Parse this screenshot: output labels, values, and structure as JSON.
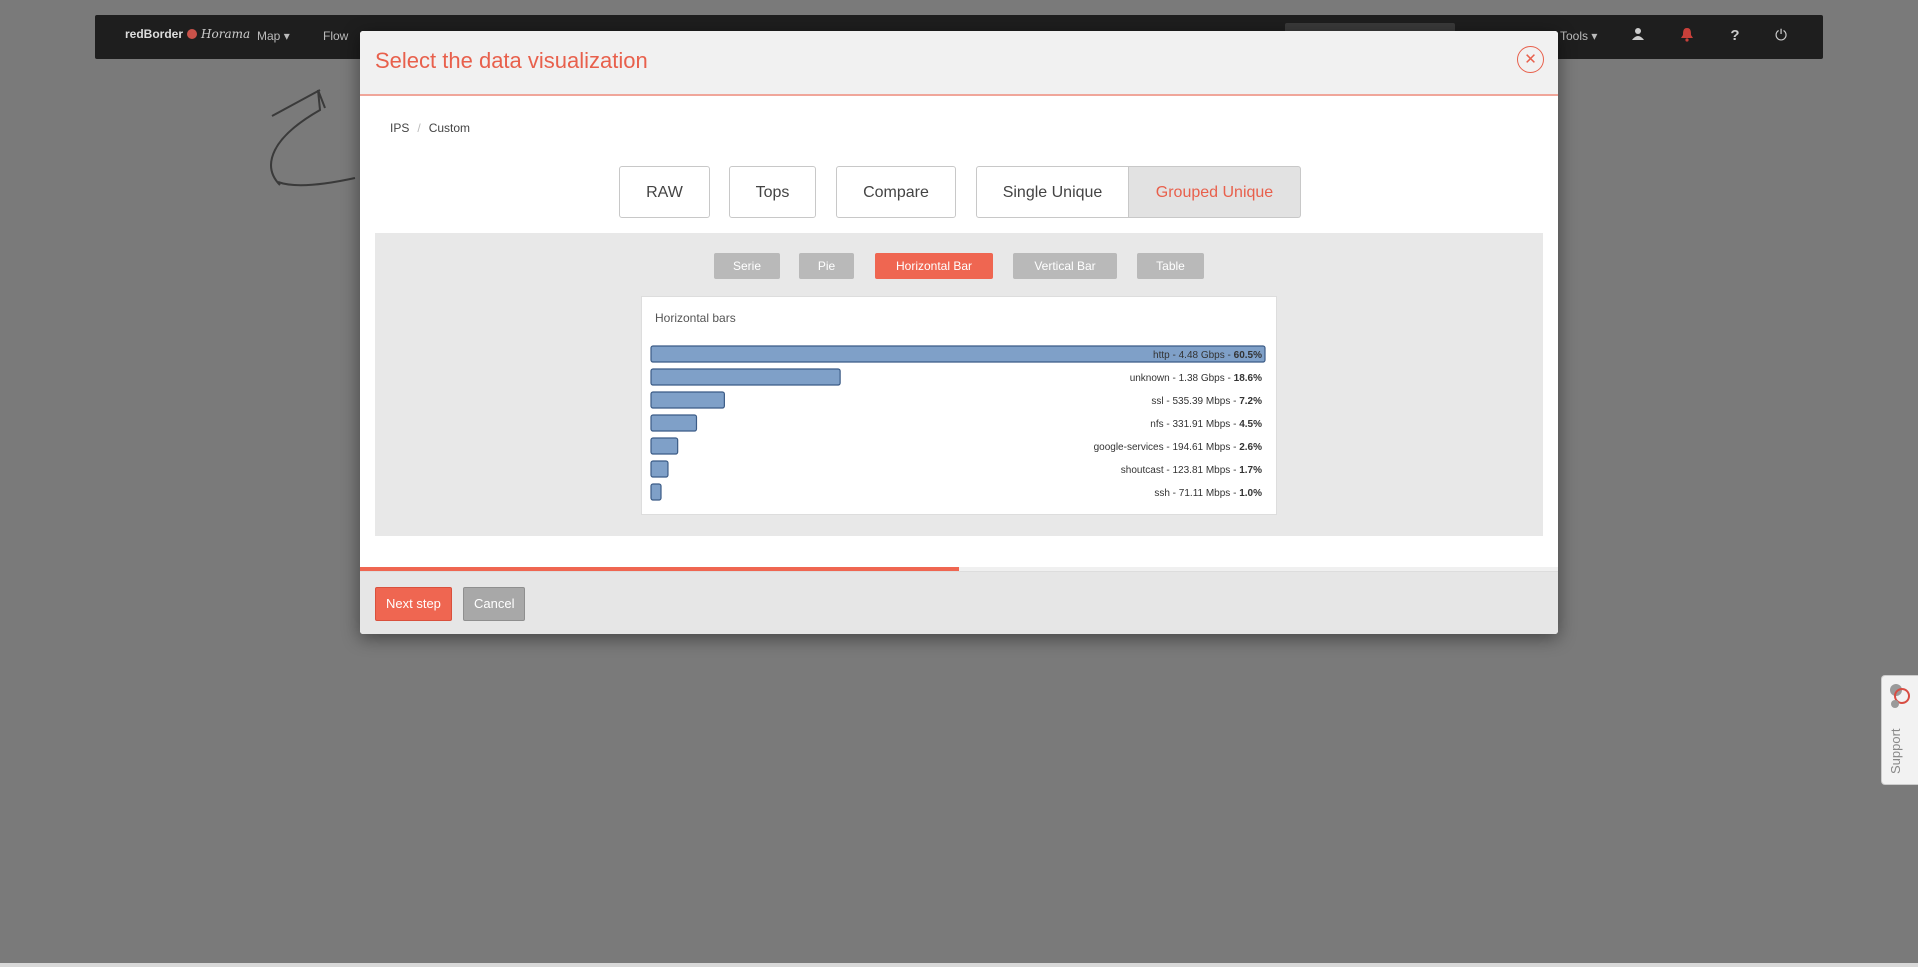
{
  "navbar": {
    "logo_text": "redBorder",
    "logo_script": "Horama",
    "items": [
      "Map",
      "Flow"
    ],
    "tools_label": "Tools"
  },
  "support": {
    "label": "Support"
  },
  "modal": {
    "title": "Select the data visualization",
    "close_icon": "close-icon",
    "breadcrumb": [
      "IPS",
      "Custom"
    ],
    "types": [
      "RAW",
      "Tops",
      "Compare"
    ],
    "unique_group": [
      "Single Unique",
      "Grouped Unique"
    ],
    "selected_type": "Grouped Unique",
    "viz_tabs": [
      "Serie",
      "Pie",
      "Horizontal Bar",
      "Vertical Bar",
      "Table"
    ],
    "selected_viz": "Horizontal Bar",
    "progress_fraction": 0.5,
    "footer": {
      "next_label": "Next step",
      "cancel_label": "Cancel"
    }
  },
  "colors": {
    "accent": "#ef6651",
    "bar_fill": "#7fa0c8",
    "bar_stroke": "#3b5b86"
  },
  "chart_data": {
    "type": "bar",
    "orientation": "horizontal",
    "title": "Horizontal bars",
    "categories": [
      "http",
      "unknown",
      "ssl",
      "nfs",
      "google-services",
      "shoutcast",
      "ssh"
    ],
    "values": [
      4.48,
      1.38,
      0.53539,
      0.33191,
      0.19461,
      0.12381,
      0.07111
    ],
    "value_labels": [
      "4.48 Gbps",
      "1.38 Gbps",
      "535.39 Mbps",
      "331.91 Mbps",
      "194.61 Mbps",
      "123.81 Mbps",
      "71.11 Mbps"
    ],
    "percent_labels": [
      "60.5%",
      "18.6%",
      "7.2%",
      "4.5%",
      "2.6%",
      "1.7%",
      "1.0%"
    ],
    "percents": [
      60.5,
      18.6,
      7.2,
      4.5,
      2.6,
      1.7,
      1.0
    ]
  }
}
